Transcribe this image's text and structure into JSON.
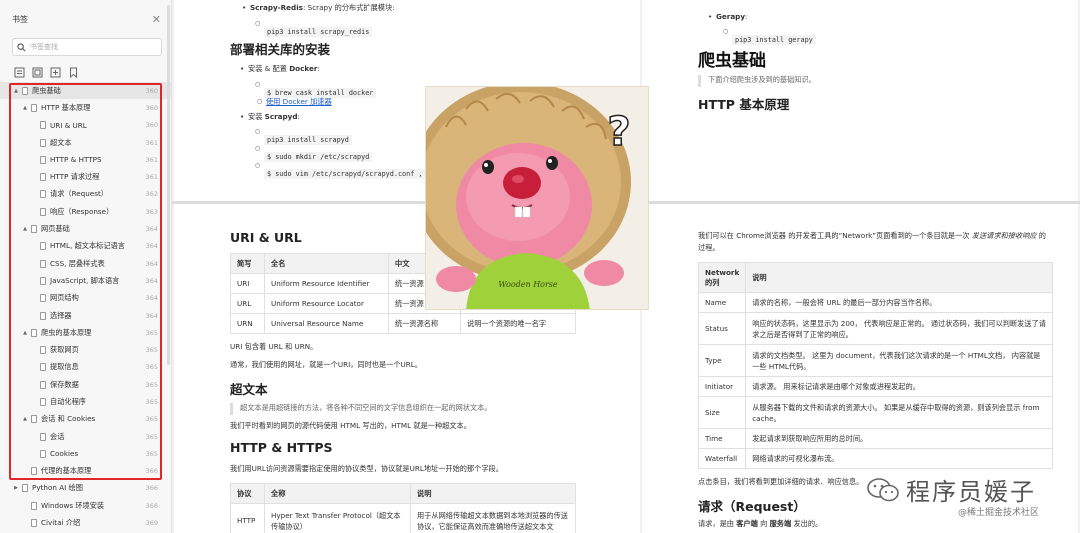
{
  "sidebar": {
    "title": "书签",
    "search_placeholder": "书签查找",
    "items": [
      {
        "label": "爬虫基础",
        "num": "360",
        "level": 0,
        "arrow": "▲"
      },
      {
        "label": "HTTP 基本原理",
        "num": "360",
        "level": 1,
        "arrow": "▲"
      },
      {
        "label": "URI & URL",
        "num": "360",
        "level": 2
      },
      {
        "label": "超文本",
        "num": "361",
        "level": 2
      },
      {
        "label": "HTTP & HTTPS",
        "num": "361",
        "level": 2
      },
      {
        "label": "HTTP 请求过程",
        "num": "361",
        "level": 2
      },
      {
        "label": "请求（Request）",
        "num": "362",
        "level": 2
      },
      {
        "label": "响应（Response）",
        "num": "363",
        "level": 2
      },
      {
        "label": "网页基础",
        "num": "364",
        "level": 1,
        "arrow": "▲"
      },
      {
        "label": "HTML, 超文本标记语言",
        "num": "364",
        "level": 2
      },
      {
        "label": "CSS, 层叠样式表",
        "num": "364",
        "level": 2
      },
      {
        "label": "JavaScript, 脚本语言",
        "num": "364",
        "level": 2
      },
      {
        "label": "网页结构",
        "num": "364",
        "level": 2
      },
      {
        "label": "选择器",
        "num": "364",
        "level": 2
      },
      {
        "label": "爬虫的基本原理",
        "num": "365",
        "level": 1,
        "arrow": "▲"
      },
      {
        "label": "获取网页",
        "num": "365",
        "level": 2
      },
      {
        "label": "提取信息",
        "num": "365",
        "level": 2
      },
      {
        "label": "保存数据",
        "num": "365",
        "level": 2
      },
      {
        "label": "自动化程序",
        "num": "365",
        "level": 2
      },
      {
        "label": "会话 和 Cookies",
        "num": "365",
        "level": 1,
        "arrow": "▲"
      },
      {
        "label": "会话",
        "num": "365",
        "level": 2
      },
      {
        "label": "Cookies",
        "num": "365",
        "level": 2
      },
      {
        "label": "代理的基本原理",
        "num": "366",
        "level": 1,
        "arrow": ""
      },
      {
        "label": "Python AI 绘图",
        "num": "366",
        "level": 0,
        "arrow": "▶"
      },
      {
        "label": "Windows 环境安装",
        "num": "366",
        "level": 1,
        "arrow": ""
      },
      {
        "label": "Civitai 介绍",
        "num": "369",
        "level": 1,
        "arrow": ""
      }
    ]
  },
  "page1": {
    "scrapy_redis_label": "Scrapy-Redis",
    "scrapy_redis_desc": ": Scrapy 的分布式扩展模块:",
    "cmd_scrapy_redis": "pip3 install scrapy_redis",
    "section_title": "部署相关库的安装",
    "docker_prefix": "安装 & 配置 ",
    "docker_bold": "Docker",
    "docker_suffix": ":",
    "cmd_docker": "$ brew cask install docker",
    "docker_link": "使用 Docker 加速器",
    "scrapyd_prefix": "安装 ",
    "scrapyd_bold": "Scrapyd",
    "scrapyd_suffix": ":",
    "cmd_scrapyd": "pip3 install scrapyd",
    "cmd_mkdir": "$ sudo mkdir /etc/scrapyd",
    "cmd_vim": "$ sudo vim /etc/scrapyd/scrapyd.conf , "
  },
  "page2": {
    "gerapy_label": "Gerapy",
    "gerapy_suffix": ":",
    "cmd_gerapy": "pip3 install gerapy",
    "title": "爬虫基础",
    "intro": "下面介绍爬虫涉及到的基础知识。",
    "section": "HTTP 基本原理"
  },
  "page3": {
    "uri_title": "URI & URL",
    "table_headers": [
      "简写",
      "全名",
      "中文",
      ""
    ],
    "table_rows": [
      [
        "URI",
        "Uniform Resource Identifier",
        "统一资源",
        ""
      ],
      [
        "URL",
        "Uniform Resource Locator",
        "统一资源",
        ""
      ],
      [
        "URN",
        "Universal Resource Name",
        "统一资源名称",
        "说明一个资源的唯一名字"
      ]
    ],
    "uri_note1": "URI 包含着 URL 和 URN。",
    "uri_note2": "通常，我们使用的网址，就是一个URI，同时也是一个URL。",
    "hypertext_title": "超文本",
    "hypertext_quote": "超文本是用超链接的方法，将各种不同空间的文字信息组织在一起的网状文本。",
    "hypertext_desc": "我们平时看到的网页的源代码使用 HTML 写出的，HTML 就是一种超文本。",
    "https_title": "HTTP & HTTPS",
    "https_desc": "我们用URL访问资源需要指定使用的协议类型，协议就是URL地址一开始的那个字段。",
    "proto_headers": [
      "协议",
      "全称",
      "说明"
    ],
    "proto_row": [
      "HTTP",
      "Hyper Text Transfer Protocol（超文本传输协议）",
      "用于从网络传输超文本数据到本地浏览器的传送协议，它能保证高效而准确地传送超文本文"
    ]
  },
  "page4": {
    "intro_a": "我们可以在 Chrome浏览器 的开发者工具的“Network”页面看到的一个条目就是一次 ",
    "intro_italic": "发送请求和接收响应",
    "intro_b": " 的",
    "intro_c": "过程。",
    "table_headers": [
      "Network 的列",
      "说明"
    ],
    "table_rows": [
      [
        "Name",
        "请求的名称，一般会将 URL 的最后一部分内容当作名称。"
      ],
      [
        "Status",
        "响应的状态码，这里显示为 200， 代表响应是正常的。 通过状态码，我们可以判断发送了请求之后是否得到了正常的响应。"
      ],
      [
        "Type",
        "请求的文档类型。 这里为 document，代表我们这次请求的是一个 HTML文档， 内容就是一些 HTML代码。"
      ],
      [
        "Initiator",
        "请求源。 用来标记请求是由哪个对象或进程发起的。"
      ],
      [
        "Size",
        "从服务器下载的文件和请求的资源大小。 如果是从缓存中取得的资源，则该列会显示 from cache。"
      ],
      [
        "Time",
        "发起请求到获取响应所用的总时间。"
      ],
      [
        "Waterfall",
        "网络请求的可视化瀑布流。"
      ]
    ],
    "after_table": "点击条目，我们将看到更加详细的请求、响应信息。",
    "request_title": "请求（Request）",
    "request_desc_a": "请求，是由 ",
    "request_client": "客户端",
    "request_desc_b": " 向 ",
    "request_server": "服务端",
    "request_desc_c": " 发出的。"
  },
  "overlay": {
    "question_mark": "?",
    "shirt_text": "Wooden Horse"
  },
  "watermark": {
    "main": "程序员媛子",
    "sub": "@稀土掘金技术社区"
  },
  "colors": {
    "highlight_border": "#e0262a",
    "link": "#1d5cd1"
  }
}
